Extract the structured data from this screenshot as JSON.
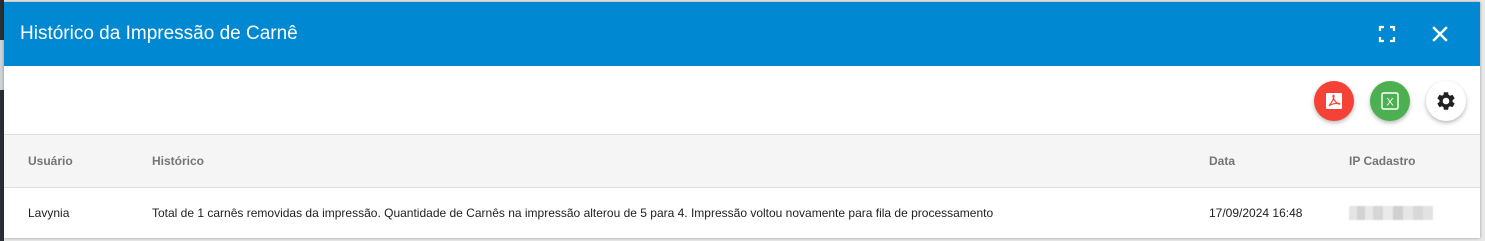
{
  "dialog": {
    "title": "Histórico da Impressão de Carnê",
    "header_color": "#0089d2",
    "actions": {
      "fullscreen_icon": "fullscreen-icon",
      "close_icon": "close-icon"
    }
  },
  "toolbar": {
    "buttons": [
      {
        "icon": "pdf-icon",
        "color": "#f44336"
      },
      {
        "icon": "excel-icon",
        "color": "#4caf50",
        "glyph": "X"
      },
      {
        "icon": "gear-icon",
        "color": "#ffffff"
      }
    ]
  },
  "table": {
    "columns": [
      "Usuário",
      "Histórico",
      "Data",
      "IP Cadastro"
    ],
    "rows": [
      {
        "usuario": "Lavynia",
        "historico": "Total de 1 carnês removidas da impressão. Quantidade de Carnês na impressão alterou de 5 para 4. Impressão voltou novamente para fila de processamento",
        "data": "17/09/2024 16:48",
        "ip_cadastro_redacted": true
      }
    ]
  }
}
